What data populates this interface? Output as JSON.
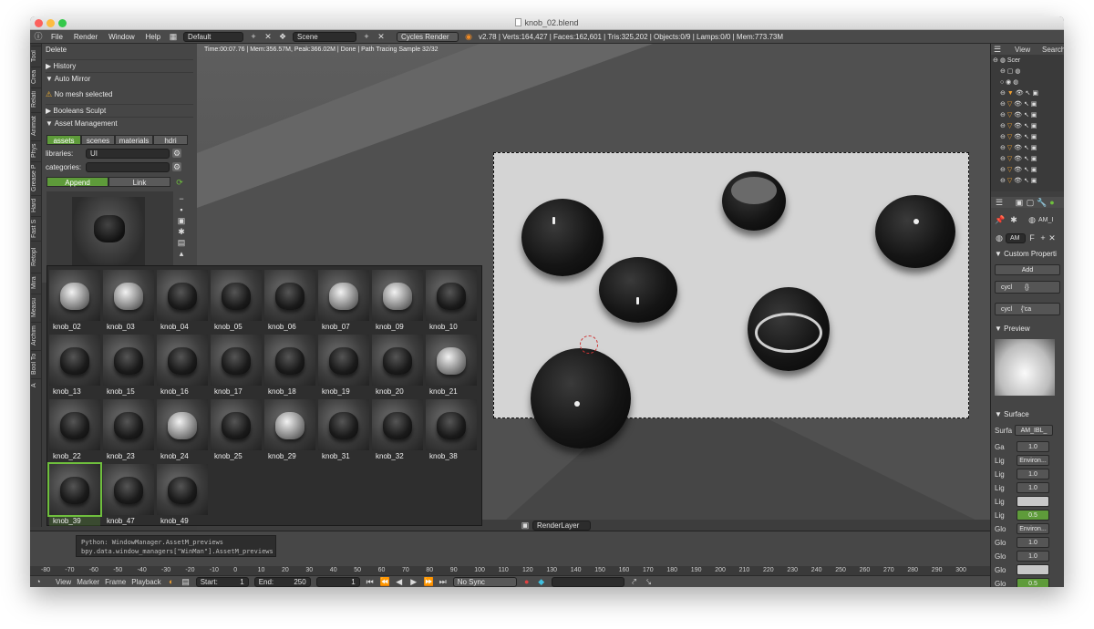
{
  "window": {
    "title": "knob_02.blend"
  },
  "menu": [
    "File",
    "Render",
    "Window",
    "Help"
  ],
  "header": {
    "layout": "Default",
    "scene": "Scene",
    "engine": "Cycles Render",
    "stats": "v2.78 | Verts:164,427 | Faces:162,601 | Tris:325,202 | Objects:0/9 | Lamps:0/0 | Mem:773.73M"
  },
  "viewport": {
    "status": "Time:00:07.76 | Mem:356.57M, Peak:366.02M | Done | Path Tracing Sample 32/32",
    "render_layer": "RenderLayer"
  },
  "vtabs": [
    "Tool",
    "Crea",
    "Relati",
    "Animat",
    "Phys",
    "Grease P",
    "Hard",
    "Fast S",
    "Retopl",
    "Mira",
    "Measu",
    "Archim",
    "Bool To",
    "A"
  ],
  "toolshelf": {
    "delete": "Delete",
    "history": "History",
    "auto_mirror": "Auto Mirror",
    "no_mesh": "No mesh selected",
    "booleans": "Booleans Sculpt",
    "asset_mgmt": "Asset Management",
    "asset_tabs": [
      "assets",
      "scenes",
      "materials",
      "hdri"
    ],
    "libraries_label": "libraries:",
    "libraries_value": "UI",
    "categories_label": "categories:",
    "append": "Append",
    "link": "Link"
  },
  "assets": [
    "knob_02",
    "knob_03",
    "knob_04",
    "knob_05",
    "knob_06",
    "knob_07",
    "knob_09",
    "knob_10",
    "knob_13",
    "knob_15",
    "knob_16",
    "knob_17",
    "knob_18",
    "knob_19",
    "knob_20",
    "knob_21",
    "knob_22",
    "knob_23",
    "knob_24",
    "knob_25",
    "knob_29",
    "knob_31",
    "knob_32",
    "knob_38",
    "knob_39",
    "knob_47",
    "knob_49"
  ],
  "outliner": {
    "view": "View",
    "search": "Search",
    "scene": "Scer"
  },
  "props": {
    "material": "AM_I",
    "slot": "AM",
    "custom": "Custom Properti",
    "add": "Add",
    "cycl1": "cycl",
    "cycl1_val": "{}",
    "cycl2": "cycl",
    "cycl2_val": "{'ca",
    "preview": "Preview",
    "surface": "Surface",
    "surface_label": "Surfa",
    "surface_value": "AM_IBL_",
    "rows": [
      {
        "label": "Ga",
        "value": "1.0"
      },
      {
        "label": "Lig",
        "value": "Environ..."
      },
      {
        "label": "Lig",
        "value": "1.0"
      },
      {
        "label": "Lig",
        "value": "1.0"
      },
      {
        "label": "Lig",
        "value": ""
      },
      {
        "label": "Lig",
        "value": "0.5"
      },
      {
        "label": "Glo",
        "value": "Environ..."
      },
      {
        "label": "Glo",
        "value": "1.0"
      },
      {
        "label": "Glo",
        "value": "1.0"
      },
      {
        "label": "Glo",
        "value": ""
      },
      {
        "label": "Glo",
        "value": "0.5"
      }
    ]
  },
  "timeline": {
    "ticks": [
      "-80",
      "-70",
      "-60",
      "-50",
      "-40",
      "-30",
      "-20",
      "-10",
      "0",
      "10",
      "20",
      "30",
      "40",
      "50",
      "60",
      "70",
      "80",
      "90",
      "100",
      "110",
      "120",
      "130",
      "140",
      "150",
      "160",
      "170",
      "180",
      "190",
      "200",
      "210",
      "220",
      "230",
      "240",
      "250",
      "260",
      "270",
      "280",
      "290",
      "300"
    ],
    "console": [
      "Python: WindowManager.AssetM_previews",
      "bpy.data.window_managers[\"WinMan\"].AssetM_previews"
    ],
    "view": "View",
    "marker": "Marker",
    "frame": "Frame",
    "playback": "Playback",
    "start_label": "Start:",
    "start": "1",
    "end_label": "End:",
    "end": "250",
    "current": "1",
    "sync": "No Sync"
  }
}
